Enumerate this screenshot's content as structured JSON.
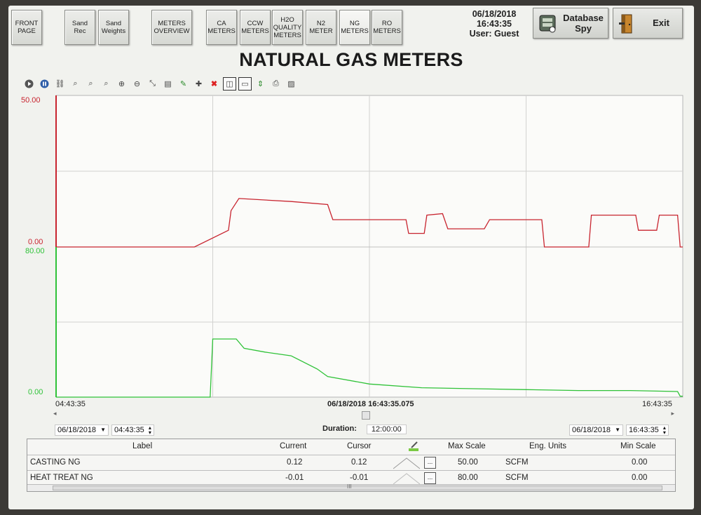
{
  "nav": {
    "front_page": "FRONT\nPAGE",
    "sand_rec": "Sand\nRec",
    "sand_weights": "Sand\nWeights",
    "meters_overview": "METERS\nOVERVIEW",
    "ca_meters": "CA\nMETERS",
    "ccw_meters": "CCW\nMETERS",
    "h2o_meters": "H2O\nQUALITY\nMETERS",
    "n2_meter": "N2\nMETER",
    "ng_meters": "NG\nMETERS",
    "ro_meters": "RO\nMETERS"
  },
  "status": {
    "date": "06/18/2018",
    "time": "16:43:35",
    "user": "User: Guest"
  },
  "database_spy": {
    "line1": "Database",
    "line2": "Spy"
  },
  "exit_label": "Exit",
  "page_title": "NATURAL GAS METERS",
  "toolbar_icons": [
    "play-icon",
    "pause-icon",
    "link-icon",
    "zoom-area-icon",
    "zoom-fit-icon",
    "zoom-prev-icon",
    "zoom-in-icon",
    "zoom-out-icon",
    "axis-reset-icon",
    "table-icon",
    "pen-icon",
    "crosshair-icon",
    "delete-icon",
    "split-view-icon",
    "single-view-icon",
    "scale-icon",
    "print-icon",
    "image-icon"
  ],
  "chart": {
    "casting_axis": {
      "max": "50.00",
      "min": "0.00",
      "color": "#c8242f"
    },
    "heat_axis": {
      "max": "80.00",
      "min": "0.00",
      "color": "#2fc238"
    },
    "x_start": "04:43:35",
    "x_cursor": "06/18/2018 16:43:35.075",
    "x_end": "16:43:35"
  },
  "chart_data": {
    "type": "line",
    "x_range": [
      "06/18/2018 04:43:35",
      "06/18/2018 16:43:35"
    ],
    "series": [
      {
        "name": "CASTING NG",
        "unit": "SCFM",
        "ylim": [
          0,
          50
        ],
        "color": "#c8242f",
        "x_hours": [
          0,
          2.5,
          2.6,
          2.65,
          3.3,
          3.35,
          3.5,
          4.5,
          5.2,
          5.3,
          6.7,
          6.75,
          7.05,
          7.1,
          7.4,
          7.5,
          8.2,
          8.3,
          9.3,
          9.35,
          10.2,
          10.25,
          11.1,
          11.15,
          11.5,
          11.55,
          11.9,
          11.95,
          12
        ],
        "values": [
          0,
          0,
          0,
          0,
          5.5,
          12,
          16,
          15,
          14,
          9,
          9,
          4.5,
          4.5,
          10.5,
          11,
          6,
          6,
          9,
          9,
          0,
          0,
          10.5,
          10.5,
          5.5,
          5.5,
          10.5,
          10.5,
          0,
          0
        ]
      },
      {
        "name": "HEAT TREAT NG",
        "unit": "SCFM",
        "ylim": [
          0,
          80
        ],
        "color": "#2fc238",
        "x_hours": [
          0,
          2.95,
          3.0,
          3.45,
          3.6,
          4.0,
          4.5,
          5.0,
          5.2,
          6.0,
          7.0,
          8.0,
          9.0,
          10.0,
          11.0,
          11.9,
          11.95,
          12
        ],
        "values": [
          0,
          0,
          31,
          31,
          26,
          24,
          22,
          15,
          11,
          7,
          5,
          4.5,
          4,
          3.5,
          3.5,
          3,
          0.5,
          0.5
        ]
      }
    ]
  },
  "time_controls": {
    "start_date": "06/18/2018",
    "start_time": "04:43:35",
    "duration_label": "Duration:",
    "duration": "12:00:00",
    "end_date": "06/18/2018",
    "end_time": "16:43:35"
  },
  "legend": {
    "headers": {
      "label": "Label",
      "current": "Current",
      "cursor": "Cursor",
      "max_scale": "Max Scale",
      "units": "Eng. Units",
      "min_scale": "Min Scale"
    },
    "rows": [
      {
        "label": "CASTING NG",
        "current": "0.12",
        "cursor": "0.12",
        "max_scale": "50.00",
        "units": "SCFM",
        "min_scale": "0.00",
        "btn": "..."
      },
      {
        "label": "HEAT TREAT NG",
        "current": "-0.01",
        "cursor": "-0.01",
        "max_scale": "80.00",
        "units": "SCFM",
        "min_scale": "0.00",
        "btn": "..."
      }
    ],
    "scroll_mark": "III"
  }
}
